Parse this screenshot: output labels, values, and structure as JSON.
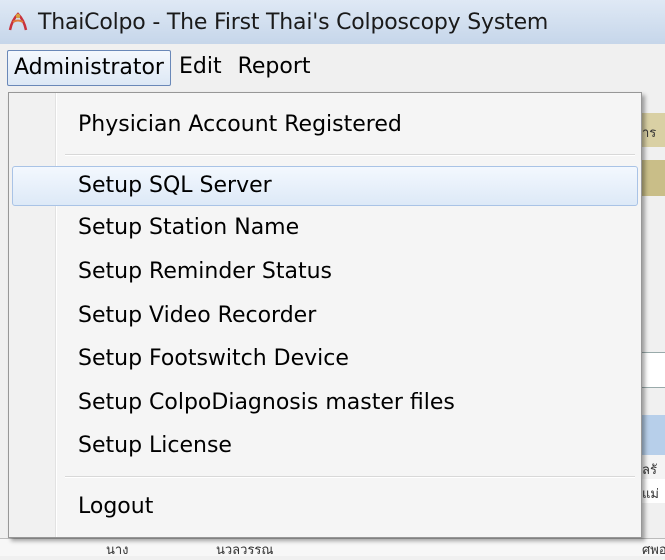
{
  "window": {
    "title": "ThaiColpo - The First Thai's Colposcopy System",
    "app_icon": "thaicolpo-app-icon"
  },
  "menubar": {
    "items": [
      {
        "label": "Administrator"
      },
      {
        "label": "Edit"
      },
      {
        "label": "Report"
      }
    ]
  },
  "dropdown": {
    "items": [
      {
        "label": "Physician Account Registered"
      },
      {
        "label": "Setup SQL Server"
      },
      {
        "label": "Setup Station Name"
      },
      {
        "label": "Setup Reminder Status"
      },
      {
        "label": "Setup Video Recorder"
      },
      {
        "label": "Setup Footswitch Device"
      },
      {
        "label": "Setup ColpoDiagnosis master files"
      },
      {
        "label": "Setup License"
      },
      {
        "label": "Logout"
      }
    ]
  },
  "background": {
    "strip_texts": [
      "าร",
      "ลรั",
      "แม่",
      "ศพอ"
    ],
    "bottom_row": [
      "นาง",
      "นวลวรรณ"
    ]
  },
  "colors": {
    "titlebar": "#c6d6ea",
    "menu_active_border": "#6a88b8",
    "hover_border": "#a9c3e6",
    "bg_header_tan": "#d8cfa0",
    "bg_blue": "#b5cde8"
  }
}
